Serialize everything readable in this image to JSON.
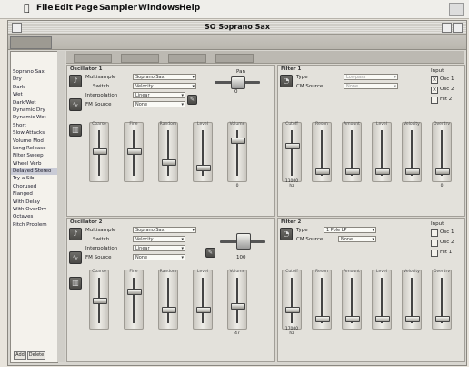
{
  "menubar": {
    "items": [
      "File",
      "Edit",
      "Page",
      "Sampler",
      "Windows",
      "Help"
    ]
  },
  "window": {
    "title": "SO Soprano Sax"
  },
  "sidebar": {
    "items": [
      "Soprano Sax",
      "Dry",
      "Dark",
      "Wet",
      "Dark/Wet",
      "Dynamic Dry",
      "Dynamic Wet",
      "Short",
      "Slow Attacks",
      "Volume Mod",
      "Long Release",
      "Filter Sweep",
      "Wheel Verb",
      "Delayed Stereo",
      "Try a Sib",
      "Chorused",
      "Flanged",
      "With Delay",
      "With OverDrv",
      "Octaves",
      "Pitch Problem"
    ],
    "selected_index": 13,
    "add_label": "Add",
    "delete_label": "Delete"
  },
  "osc1": {
    "header": "Oscillator 1",
    "multisample_label": "Multisample",
    "multisample_value": "Soprano Sax",
    "switch_label": "Switch",
    "switch_value": "Velocity",
    "interp_label": "Interpolation",
    "interp_value": "Linear",
    "fm_label": "FM Source",
    "fm_value": "None",
    "pan_label": "Pan",
    "pan_value": "0",
    "sliders": [
      {
        "name": "Coarse",
        "value": ""
      },
      {
        "name": "Fine",
        "value": ""
      },
      {
        "name": "Random",
        "value": ""
      },
      {
        "name": "Level",
        "value": ""
      },
      {
        "name": "Volume",
        "value": "0"
      }
    ]
  },
  "filter1": {
    "header": "Filter 1",
    "type_label": "Type",
    "type_value": "Lowpass",
    "cm_label": "CM Source",
    "cm_value": "None",
    "input_label": "Input",
    "inputs": [
      {
        "label": "Osc 1",
        "checked": true
      },
      {
        "label": "Osc 2",
        "checked": true
      },
      {
        "label": "Filt 2",
        "checked": false
      }
    ],
    "sliders": [
      {
        "name": "Cutoff",
        "value": "11000 hz"
      },
      {
        "name": "Reson",
        "value": ""
      },
      {
        "name": "Amount",
        "value": ""
      },
      {
        "name": "Level",
        "value": ""
      },
      {
        "name": "Velocity",
        "value": ""
      },
      {
        "name": "Overdrv",
        "value": "0"
      }
    ]
  },
  "osc2": {
    "header": "Oscillator 2",
    "multisample_label": "Multisample",
    "multisample_value": "Soprano Sax",
    "switch_label": "Switch",
    "switch_value": "Velocity",
    "interp_label": "Interpolation",
    "interp_value": "Linear",
    "fm_label": "FM Source",
    "fm_value": "None",
    "pan_label": "Pan",
    "pan_value": "100",
    "sliders": [
      {
        "name": "Coarse",
        "value": ""
      },
      {
        "name": "Fine",
        "value": ""
      },
      {
        "name": "Random",
        "value": ""
      },
      {
        "name": "Level",
        "value": ""
      },
      {
        "name": "Volume",
        "value": "47"
      }
    ]
  },
  "filter2": {
    "header": "Filter 2",
    "type_label": "Type",
    "type_value": "1 Pole LP",
    "cm_label": "CM Source",
    "cm_value": "None",
    "input_label": "Input",
    "inputs": [
      {
        "label": "Osc 1",
        "checked": false
      },
      {
        "label": "Osc 2",
        "checked": false
      },
      {
        "label": "Filt 1",
        "checked": false
      }
    ],
    "sliders": [
      {
        "name": "Cutoff",
        "value": "17000 hz"
      },
      {
        "name": "Reson",
        "value": ""
      },
      {
        "name": "Amount",
        "value": ""
      },
      {
        "name": "Level",
        "value": ""
      },
      {
        "name": "Velocity",
        "value": ""
      },
      {
        "name": "Overdrv",
        "value": ""
      }
    ]
  }
}
